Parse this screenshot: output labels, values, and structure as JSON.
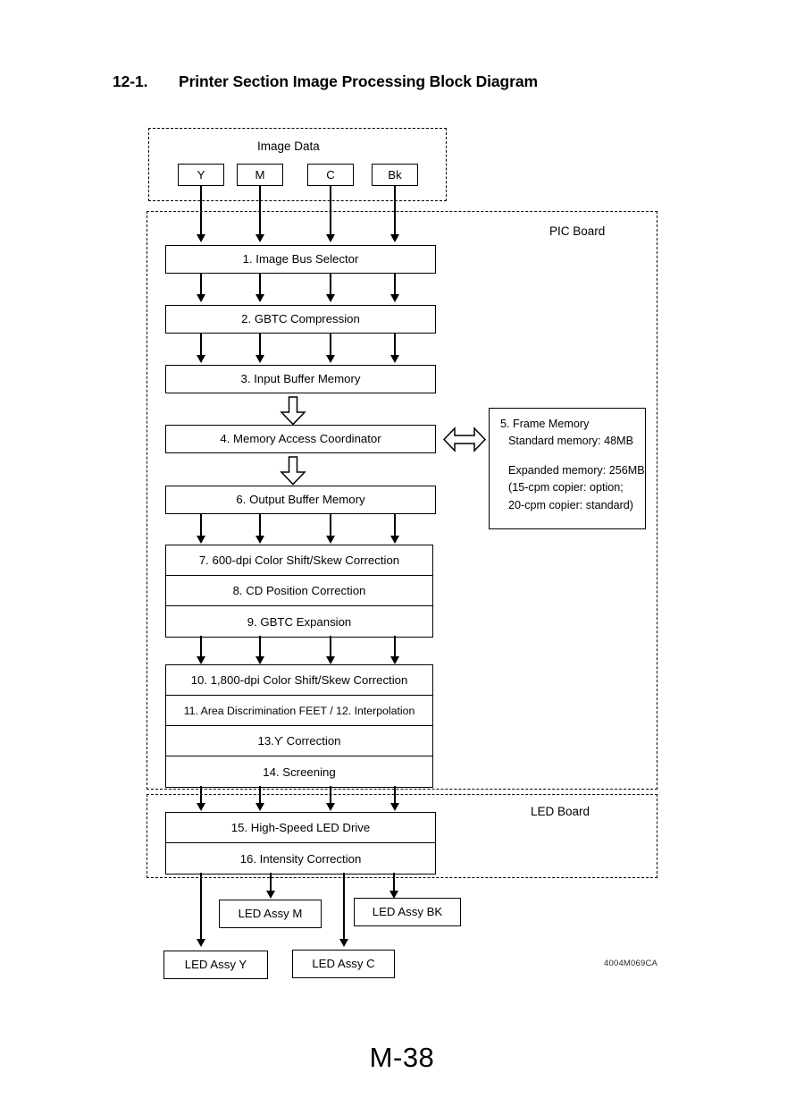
{
  "page": {
    "title_number": "12-1.",
    "title_text": "Printer Section Image Processing Block Diagram",
    "page_number": "M-38",
    "doc_code": "4004M069CA"
  },
  "image_data_group": {
    "label": "Image Data",
    "channels": [
      {
        "label": "Y"
      },
      {
        "label": "M"
      },
      {
        "label": "C"
      },
      {
        "label": "Bk"
      }
    ]
  },
  "pic_board": {
    "label": "PIC Board",
    "blocks": [
      {
        "id": "1",
        "label": "1. Image Bus Selector"
      },
      {
        "id": "2",
        "label": "2. GBTC Compression"
      },
      {
        "id": "3",
        "label": "3. Input Buffer Memory"
      },
      {
        "id": "4",
        "label": "4. Memory Access Coordinator"
      },
      {
        "id": "6",
        "label": "6. Output Buffer Memory"
      },
      {
        "id": "7",
        "label": "7. 600-dpi Color Shift/Skew Correction"
      },
      {
        "id": "8",
        "label": "8. CD Position Correction"
      },
      {
        "id": "9",
        "label": "9. GBTC Expansion"
      },
      {
        "id": "10",
        "label": "10. 1,800-dpi Color Shift/Skew Correction"
      },
      {
        "id": "11",
        "label": "11. Area Discrimination FEET / 12. Interpolation"
      },
      {
        "id": "13",
        "label": "13.ϒ Correction"
      },
      {
        "id": "14",
        "label": "14. Screening"
      }
    ]
  },
  "frame_memory": {
    "title": "5. Frame Memory",
    "standard": "Standard memory: 48MB",
    "expanded": "Expanded memory: 256MB",
    "note_line1": "(15-cpm copier: option;",
    "note_line2": "20-cpm copier: standard)"
  },
  "led_board": {
    "label": "LED Board",
    "blocks": [
      {
        "id": "15",
        "label": "15. High-Speed LED Drive"
      },
      {
        "id": "16",
        "label": "16. Intensity Correction"
      }
    ]
  },
  "led_assemblies": [
    {
      "label": "LED Assy M"
    },
    {
      "label": "LED Assy BK"
    },
    {
      "label": "LED Assy Y"
    },
    {
      "label": "LED Assy C"
    }
  ]
}
